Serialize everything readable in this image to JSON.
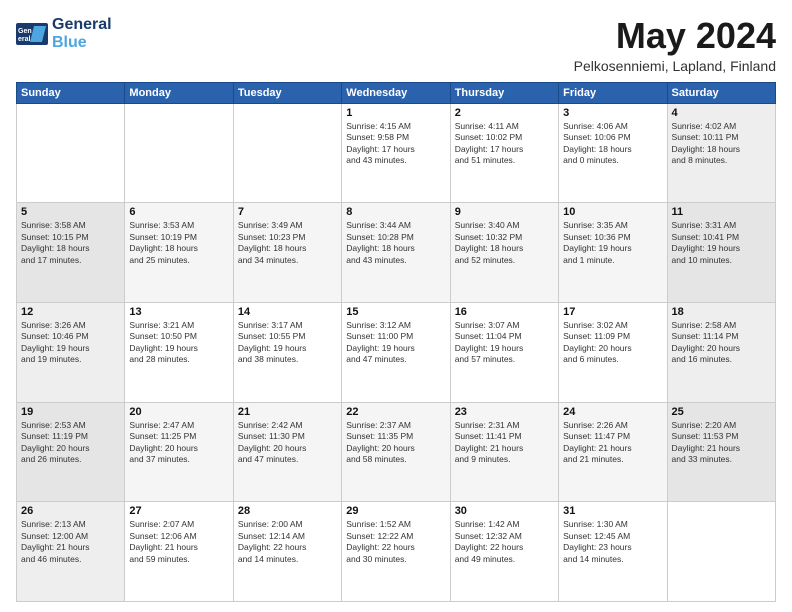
{
  "header": {
    "logo_line1": "General",
    "logo_line2": "Blue",
    "month": "May 2024",
    "location": "Pelkosenniemi, Lapland, Finland"
  },
  "weekdays": [
    "Sunday",
    "Monday",
    "Tuesday",
    "Wednesday",
    "Thursday",
    "Friday",
    "Saturday"
  ],
  "weeks": [
    [
      {
        "day": "",
        "info": ""
      },
      {
        "day": "",
        "info": ""
      },
      {
        "day": "",
        "info": ""
      },
      {
        "day": "1",
        "info": "Sunrise: 4:15 AM\nSunset: 9:58 PM\nDaylight: 17 hours\nand 43 minutes."
      },
      {
        "day": "2",
        "info": "Sunrise: 4:11 AM\nSunset: 10:02 PM\nDaylight: 17 hours\nand 51 minutes."
      },
      {
        "day": "3",
        "info": "Sunrise: 4:06 AM\nSunset: 10:06 PM\nDaylight: 18 hours\nand 0 minutes."
      },
      {
        "day": "4",
        "info": "Sunrise: 4:02 AM\nSunset: 10:11 PM\nDaylight: 18 hours\nand 8 minutes."
      }
    ],
    [
      {
        "day": "5",
        "info": "Sunrise: 3:58 AM\nSunset: 10:15 PM\nDaylight: 18 hours\nand 17 minutes."
      },
      {
        "day": "6",
        "info": "Sunrise: 3:53 AM\nSunset: 10:19 PM\nDaylight: 18 hours\nand 25 minutes."
      },
      {
        "day": "7",
        "info": "Sunrise: 3:49 AM\nSunset: 10:23 PM\nDaylight: 18 hours\nand 34 minutes."
      },
      {
        "day": "8",
        "info": "Sunrise: 3:44 AM\nSunset: 10:28 PM\nDaylight: 18 hours\nand 43 minutes."
      },
      {
        "day": "9",
        "info": "Sunrise: 3:40 AM\nSunset: 10:32 PM\nDaylight: 18 hours\nand 52 minutes."
      },
      {
        "day": "10",
        "info": "Sunrise: 3:35 AM\nSunset: 10:36 PM\nDaylight: 19 hours\nand 1 minute."
      },
      {
        "day": "11",
        "info": "Sunrise: 3:31 AM\nSunset: 10:41 PM\nDaylight: 19 hours\nand 10 minutes."
      }
    ],
    [
      {
        "day": "12",
        "info": "Sunrise: 3:26 AM\nSunset: 10:46 PM\nDaylight: 19 hours\nand 19 minutes."
      },
      {
        "day": "13",
        "info": "Sunrise: 3:21 AM\nSunset: 10:50 PM\nDaylight: 19 hours\nand 28 minutes."
      },
      {
        "day": "14",
        "info": "Sunrise: 3:17 AM\nSunset: 10:55 PM\nDaylight: 19 hours\nand 38 minutes."
      },
      {
        "day": "15",
        "info": "Sunrise: 3:12 AM\nSunset: 11:00 PM\nDaylight: 19 hours\nand 47 minutes."
      },
      {
        "day": "16",
        "info": "Sunrise: 3:07 AM\nSunset: 11:04 PM\nDaylight: 19 hours\nand 57 minutes."
      },
      {
        "day": "17",
        "info": "Sunrise: 3:02 AM\nSunset: 11:09 PM\nDaylight: 20 hours\nand 6 minutes."
      },
      {
        "day": "18",
        "info": "Sunrise: 2:58 AM\nSunset: 11:14 PM\nDaylight: 20 hours\nand 16 minutes."
      }
    ],
    [
      {
        "day": "19",
        "info": "Sunrise: 2:53 AM\nSunset: 11:19 PM\nDaylight: 20 hours\nand 26 minutes."
      },
      {
        "day": "20",
        "info": "Sunrise: 2:47 AM\nSunset: 11:25 PM\nDaylight: 20 hours\nand 37 minutes."
      },
      {
        "day": "21",
        "info": "Sunrise: 2:42 AM\nSunset: 11:30 PM\nDaylight: 20 hours\nand 47 minutes."
      },
      {
        "day": "22",
        "info": "Sunrise: 2:37 AM\nSunset: 11:35 PM\nDaylight: 20 hours\nand 58 minutes."
      },
      {
        "day": "23",
        "info": "Sunrise: 2:31 AM\nSunset: 11:41 PM\nDaylight: 21 hours\nand 9 minutes."
      },
      {
        "day": "24",
        "info": "Sunrise: 2:26 AM\nSunset: 11:47 PM\nDaylight: 21 hours\nand 21 minutes."
      },
      {
        "day": "25",
        "info": "Sunrise: 2:20 AM\nSunset: 11:53 PM\nDaylight: 21 hours\nand 33 minutes."
      }
    ],
    [
      {
        "day": "26",
        "info": "Sunrise: 2:13 AM\nSunset: 12:00 AM\nDaylight: 21 hours\nand 46 minutes."
      },
      {
        "day": "27",
        "info": "Sunrise: 2:07 AM\nSunset: 12:06 AM\nDaylight: 21 hours\nand 59 minutes."
      },
      {
        "day": "28",
        "info": "Sunrise: 2:00 AM\nSunset: 12:14 AM\nDaylight: 22 hours\nand 14 minutes."
      },
      {
        "day": "29",
        "info": "Sunrise: 1:52 AM\nSunset: 12:22 AM\nDaylight: 22 hours\nand 30 minutes."
      },
      {
        "day": "30",
        "info": "Sunrise: 1:42 AM\nSunset: 12:32 AM\nDaylight: 22 hours\nand 49 minutes."
      },
      {
        "day": "31",
        "info": "Sunrise: 1:30 AM\nSunset: 12:45 AM\nDaylight: 23 hours\nand 14 minutes."
      },
      {
        "day": "",
        "info": ""
      }
    ]
  ]
}
